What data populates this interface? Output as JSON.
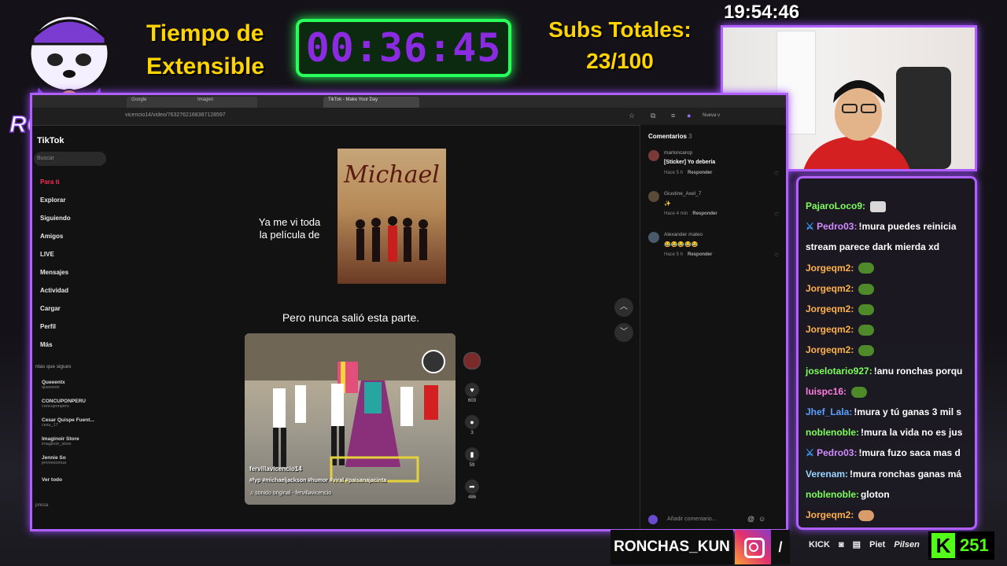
{
  "overlay": {
    "timer_label_line1": "Tiempo de",
    "timer_label_line2": "Extensible",
    "timer_value": "00:36:45",
    "subs_label": "Subs Totales:",
    "subs_value": "23/100",
    "clock": "19:54:46",
    "logo_text": "RONCHAS",
    "handle": "RONCHAS_KUN",
    "sponsors": [
      "KICK",
      "Piet",
      "Pilsen"
    ],
    "kick_count": "251",
    "colors": {
      "accent": "#b060ff",
      "timer": "#29ff5a",
      "gold": "#ffd400",
      "kick": "#53fc18"
    }
  },
  "browser": {
    "tabs": [
      "Google",
      "Imagen",
      "TikTok - Make Your Day"
    ],
    "url": "vicencio14/video/7632762168387128597",
    "new_label": "Nueva v"
  },
  "tiktok": {
    "logo": "TikTok",
    "search_placeholder": "Buscar",
    "nav": [
      "Para ti",
      "Explorar",
      "Siguiendo",
      "Amigos",
      "LIVE",
      "Mensajes",
      "Actividad",
      "Cargar",
      "Perfil",
      "Más"
    ],
    "following_header": "ntas que sigues",
    "following": [
      {
        "name": "Queeentx",
        "handle": "queeentx"
      },
      {
        "name": "CONCUPONPERU",
        "handle": "concuponperu"
      },
      {
        "name": "Cesar Quispe Fuent...",
        "handle": "cesu_17"
      },
      {
        "name": "Imaginoir Store",
        "handle": "imaginoir_store"
      },
      {
        "name": "Jennie So",
        "handle": "jenniesomua"
      }
    ],
    "see_all": "Ver todo",
    "company": "presa",
    "caption1_line1": "Ya me vi toda",
    "caption1_line2": "la película de",
    "poster_title": "Michael",
    "caption2": "Pero nunca salió esta parte.",
    "video": {
      "author": "fervillavicencio14",
      "tags": "#fyp #michaeljackson #humor #viral #paisanajacinta",
      "sound": "sonido original - fervillavicencio",
      "likes": "603",
      "comments": "3",
      "saves": "59",
      "shares": "486"
    },
    "comments_title": "Comentarios",
    "comments_count": "3",
    "comments": [
      {
        "user": "marloncarop",
        "text": "[Sticker] Yo debería",
        "time": "Hace 5 h"
      },
      {
        "user": "Giustine_Axel_7",
        "text": "✨",
        "time": "Hace 4 min"
      },
      {
        "user": "Alexander mateo",
        "text": "😂😂😂😂😂",
        "time": "Hace 5 h"
      }
    ],
    "reply_label": "Responder",
    "comment_placeholder": "Añadir comentario..."
  },
  "chat": [
    {
      "user": "PajaroLoco9:",
      "text": "",
      "color": "#7dff5a",
      "emote": "cat"
    },
    {
      "user": "Pedro03:",
      "text": "!mura puedes reinicia",
      "color": "#d28bff",
      "pick": true
    },
    {
      "user": "",
      "text": "stream parece dark mierda xd",
      "color": "#fff"
    },
    {
      "user": "Jorgeqm2:",
      "text": "",
      "color": "#ffb14a",
      "emote": "frog"
    },
    {
      "user": "Jorgeqm2:",
      "text": "",
      "color": "#ffb14a",
      "emote": "frog"
    },
    {
      "user": "Jorgeqm2:",
      "text": "",
      "color": "#ffb14a",
      "emote": "frog"
    },
    {
      "user": "Jorgeqm2:",
      "text": "",
      "color": "#ffb14a",
      "emote": "frog"
    },
    {
      "user": "Jorgeqm2:",
      "text": "",
      "color": "#ffb14a",
      "emote": "frog"
    },
    {
      "user": "joselotario927:",
      "text": "!anu ronchas porqu",
      "color": "#7dff5a"
    },
    {
      "user": "luispc16:",
      "text": "",
      "color": "#ff7de0",
      "emote": "frog"
    },
    {
      "user": "Jhef_Lala:",
      "text": "!mura y tú ganas 3 mil s",
      "color": "#5aa0ff"
    },
    {
      "user": "noblenoble:",
      "text": "!mura la vida no es jus",
      "color": "#7dff5a"
    },
    {
      "user": "Pedro03:",
      "text": "!mura fuzo saca mas d",
      "color": "#d28bff",
      "pick": true
    },
    {
      "user": "Verenam:",
      "text": "!mura ronchas ganas má",
      "color": "#9ad7ff"
    },
    {
      "user": "noblenoble:",
      "text": "gloton",
      "color": "#7dff5a"
    },
    {
      "user": "Jorgeqm2:",
      "text": "",
      "color": "#ffb14a",
      "emote": "face"
    }
  ]
}
